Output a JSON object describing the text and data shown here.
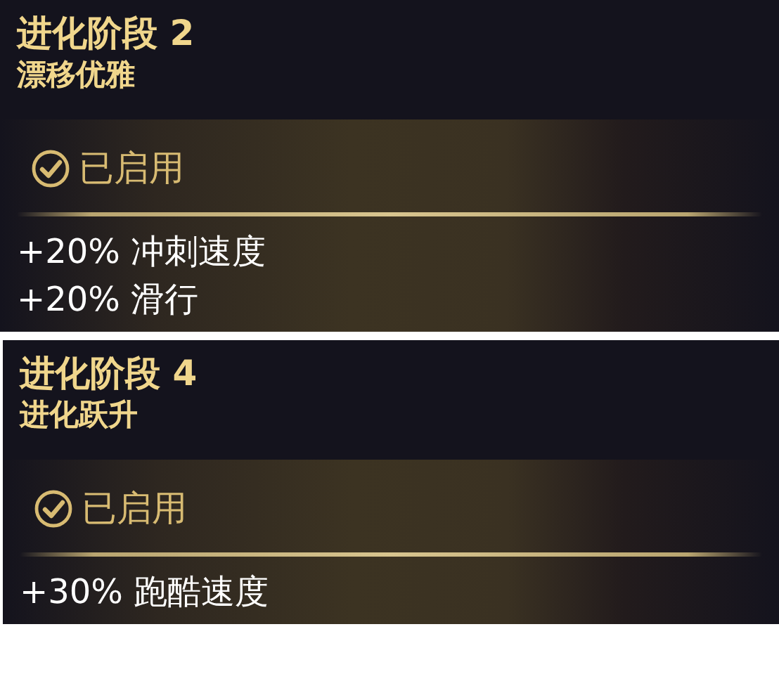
{
  "stages": [
    {
      "title": "进化阶段 2",
      "subtitle": "漂移优雅",
      "status": "已启用",
      "enabled": true,
      "effects": [
        "+20% 冲刺速度",
        "+20% 滑行"
      ]
    },
    {
      "title": "进化阶段 4",
      "subtitle": "进化跃升",
      "status": "已启用",
      "enabled": true,
      "effects": [
        "+30% 跑酷速度"
      ]
    }
  ]
}
